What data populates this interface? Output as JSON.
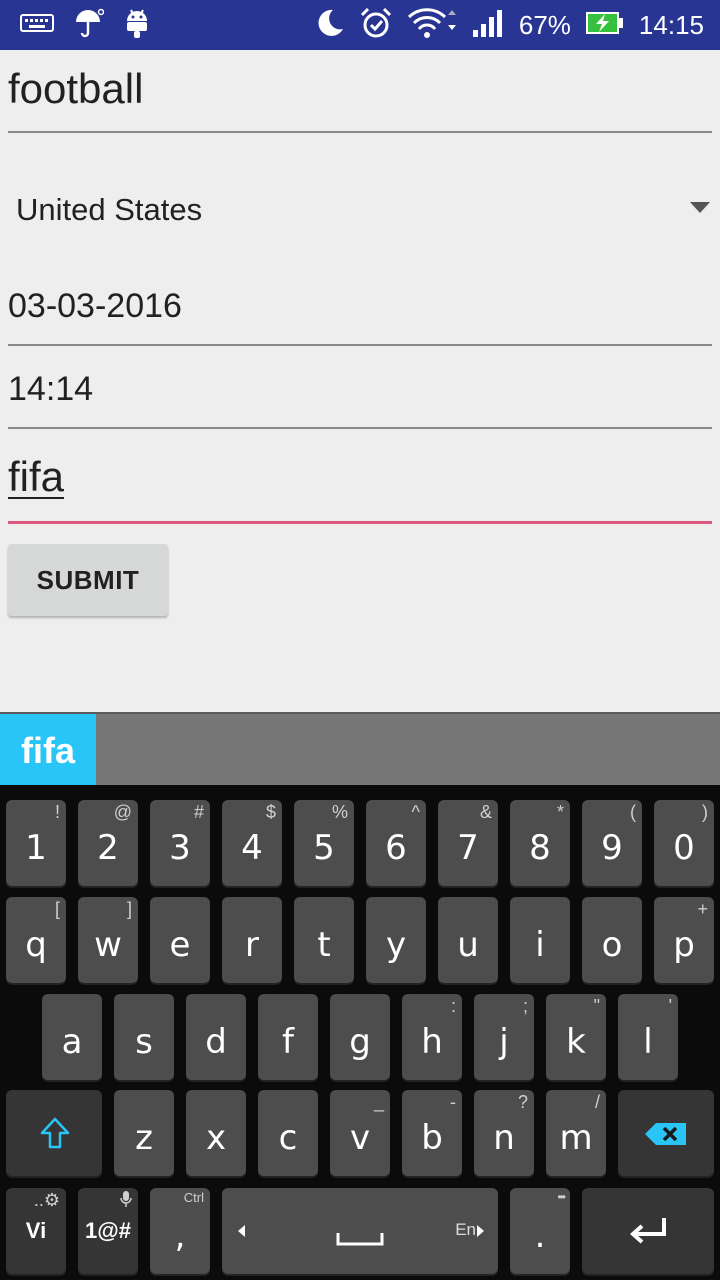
{
  "status_bar": {
    "battery": "67%",
    "time": "14:15",
    "icons_left": [
      "keyboard-icon",
      "umbrella-icon",
      "android-icon"
    ],
    "icons_right": [
      "moon-icon",
      "alarm-icon",
      "wifi-icon",
      "signal-icon",
      "battery-charging-icon"
    ]
  },
  "form": {
    "name_value": "football",
    "country_value": "United States",
    "date_value": "03-03-2016",
    "time_value": "14:14",
    "tag_value": "fifa",
    "submit_label": "SUBMIT"
  },
  "keyboard": {
    "suggestion": "fifa",
    "row1": [
      {
        "main": "1",
        "alt": "!"
      },
      {
        "main": "2",
        "alt": "@"
      },
      {
        "main": "3",
        "alt": "#"
      },
      {
        "main": "4",
        "alt": "$"
      },
      {
        "main": "5",
        "alt": "%"
      },
      {
        "main": "6",
        "alt": "^"
      },
      {
        "main": "7",
        "alt": "&"
      },
      {
        "main": "8",
        "alt": "*"
      },
      {
        "main": "9",
        "alt": "("
      },
      {
        "main": "0",
        "alt": ")"
      }
    ],
    "row2": [
      {
        "main": "q",
        "alt": "["
      },
      {
        "main": "w",
        "alt": "]"
      },
      {
        "main": "e",
        "alt": ""
      },
      {
        "main": "r",
        "alt": ""
      },
      {
        "main": "t",
        "alt": ""
      },
      {
        "main": "y",
        "alt": ""
      },
      {
        "main": "u",
        "alt": ""
      },
      {
        "main": "i",
        "alt": ""
      },
      {
        "main": "o",
        "alt": ""
      },
      {
        "main": "p",
        "alt": "+"
      }
    ],
    "row3": [
      {
        "main": "a",
        "alt": ""
      },
      {
        "main": "s",
        "alt": ""
      },
      {
        "main": "d",
        "alt": ""
      },
      {
        "main": "f",
        "alt": ""
      },
      {
        "main": "g",
        "alt": ""
      },
      {
        "main": "h",
        "alt": ":"
      },
      {
        "main": "j",
        "alt": ";"
      },
      {
        "main": "k",
        "alt": "\""
      },
      {
        "main": "l",
        "alt": "'"
      }
    ],
    "row4": [
      {
        "main": "z",
        "alt": ""
      },
      {
        "main": "x",
        "alt": ""
      },
      {
        "main": "c",
        "alt": ""
      },
      {
        "main": "v",
        "alt": "_"
      },
      {
        "main": "b",
        "alt": "-"
      },
      {
        "main": "n",
        "alt": "?"
      },
      {
        "main": "m",
        "alt": "/"
      }
    ],
    "lang_label": "Vi",
    "symbols_label": "1@#",
    "comma_label": ",",
    "comma_alt": "Ctrl",
    "space_lang": "En",
    "period_label": ".",
    "period_alt": "•••",
    "accent_color": "#29c5f6"
  }
}
